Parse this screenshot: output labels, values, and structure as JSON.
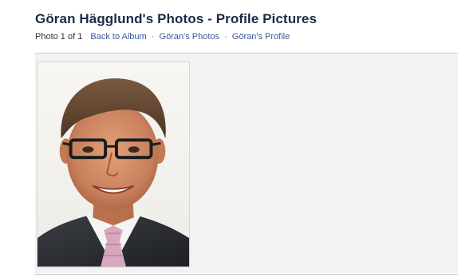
{
  "header": {
    "title": "Göran Hägglund's Photos - Profile Pictures"
  },
  "nav": {
    "counter": "Photo 1 of 1",
    "links": [
      {
        "label": "Back to Album"
      },
      {
        "label": "Göran's Photos"
      },
      {
        "label": "Göran's Profile"
      }
    ],
    "separator": "·"
  },
  "photo": {
    "subject": "profile-photo-man-with-glasses",
    "colors": {
      "background": "#f2f2f2",
      "link": "#3b5998",
      "title": "#1c2a47"
    }
  }
}
